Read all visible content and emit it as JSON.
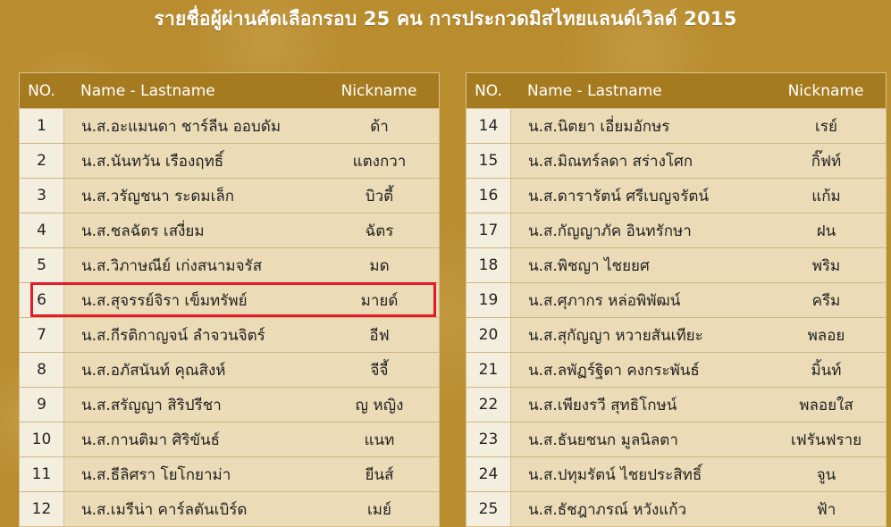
{
  "title": "รายชื่อผู้ผ่านคัดเลือกรอบ 25 คน การประกวดมิสไทยแลนด์เวิลด์ 2015",
  "headers": {
    "no": "NO.",
    "name": "Name - Lastname",
    "nickname": "Nickname"
  },
  "colors": {
    "highlight": "#e3192c",
    "header_bg": "#a67b20"
  },
  "left_rows": [
    {
      "no": "1",
      "name": "น.ส.อะแมนดา ชาร์ลีน ออบดัม",
      "nickname": "ด้า"
    },
    {
      "no": "2",
      "name": "น.ส.นันทวัน เรืองฤทธิ์",
      "nickname": "แตงกวา"
    },
    {
      "no": "3",
      "name": "น.ส.วรัญชนา ระดมเล็ก",
      "nickname": "บิวตี้"
    },
    {
      "no": "4",
      "name": "น.ส.ชลฉัตร เสงี่ยม",
      "nickname": "ฉัตร"
    },
    {
      "no": "5",
      "name": "น.ส.วิภาษณีย์ เก่งสนามจรัส",
      "nickname": "มด"
    },
    {
      "no": "6",
      "name": "น.ส.สุจรรย์จิรา เข็มทรัพย์",
      "nickname": "มายด์"
    },
    {
      "no": "7",
      "name": "น.ส.กีรติกาญจน์ ลำจวนจิตร์",
      "nickname": "อีฟ"
    },
    {
      "no": "8",
      "name": "น.ส.อภัสนันท์ คุณสิงห์",
      "nickname": "จีจี้"
    },
    {
      "no": "9",
      "name": "น.ส.สรัญญา สิริปรีชา",
      "nickname": "ญ หญิง"
    },
    {
      "no": "10",
      "name": "น.ส.กานติมา ศิริขันธ์",
      "nickname": "แนท"
    },
    {
      "no": "11",
      "name": "น.ส.ธีลิศรา โยโกยาม่า",
      "nickname": "ยีนส์"
    },
    {
      "no": "12",
      "name": "น.ส.เมรีน่า คาร์ลตันเบิร์ด",
      "nickname": "เมย์"
    }
  ],
  "right_rows": [
    {
      "no": "14",
      "name": "น.ส.นิตยา เอี่ยมอักษร",
      "nickname": "เรย์"
    },
    {
      "no": "15",
      "name": "น.ส.มิณทร์ลดา สร่างโศก",
      "nickname": "กิ๊ฟท์"
    },
    {
      "no": "16",
      "name": "น.ส.ดารารัตน์ ศรีเบญจรัตน์",
      "nickname": "แก้ม"
    },
    {
      "no": "17",
      "name": "น.ส.กัญญาภัค อินทรักษา",
      "nickname": "ฝน"
    },
    {
      "no": "18",
      "name": "น.ส.พิชญา ไชยยศ",
      "nickname": "พริม"
    },
    {
      "no": "19",
      "name": "น.ส.ศุภากร หล่อพิพัฒน์",
      "nickname": "ครีม"
    },
    {
      "no": "20",
      "name": "น.ส.สุกัญญา หวายสันเทียะ",
      "nickname": "พลอย"
    },
    {
      "no": "21",
      "name": "น.ส.ลพัฏร์ฐิดา คงกระพันธ์",
      "nickname": "มิ้นท์"
    },
    {
      "no": "22",
      "name": "น.ส.เพียงรวี สุทธิโกษน์",
      "nickname": "พลอยใส"
    },
    {
      "no": "23",
      "name": "น.ส.ธันยชนก มูลนิลตา",
      "nickname": "เฟรันฟราย"
    },
    {
      "no": "24",
      "name": "น.ส.ปทุมรัตน์ ไชยประสิทธิ์",
      "nickname": "จูน"
    },
    {
      "no": "25",
      "name": "น.ส.ธัชฎาภรณ์ หวังแก้ว",
      "nickname": "ฟ้า"
    }
  ]
}
